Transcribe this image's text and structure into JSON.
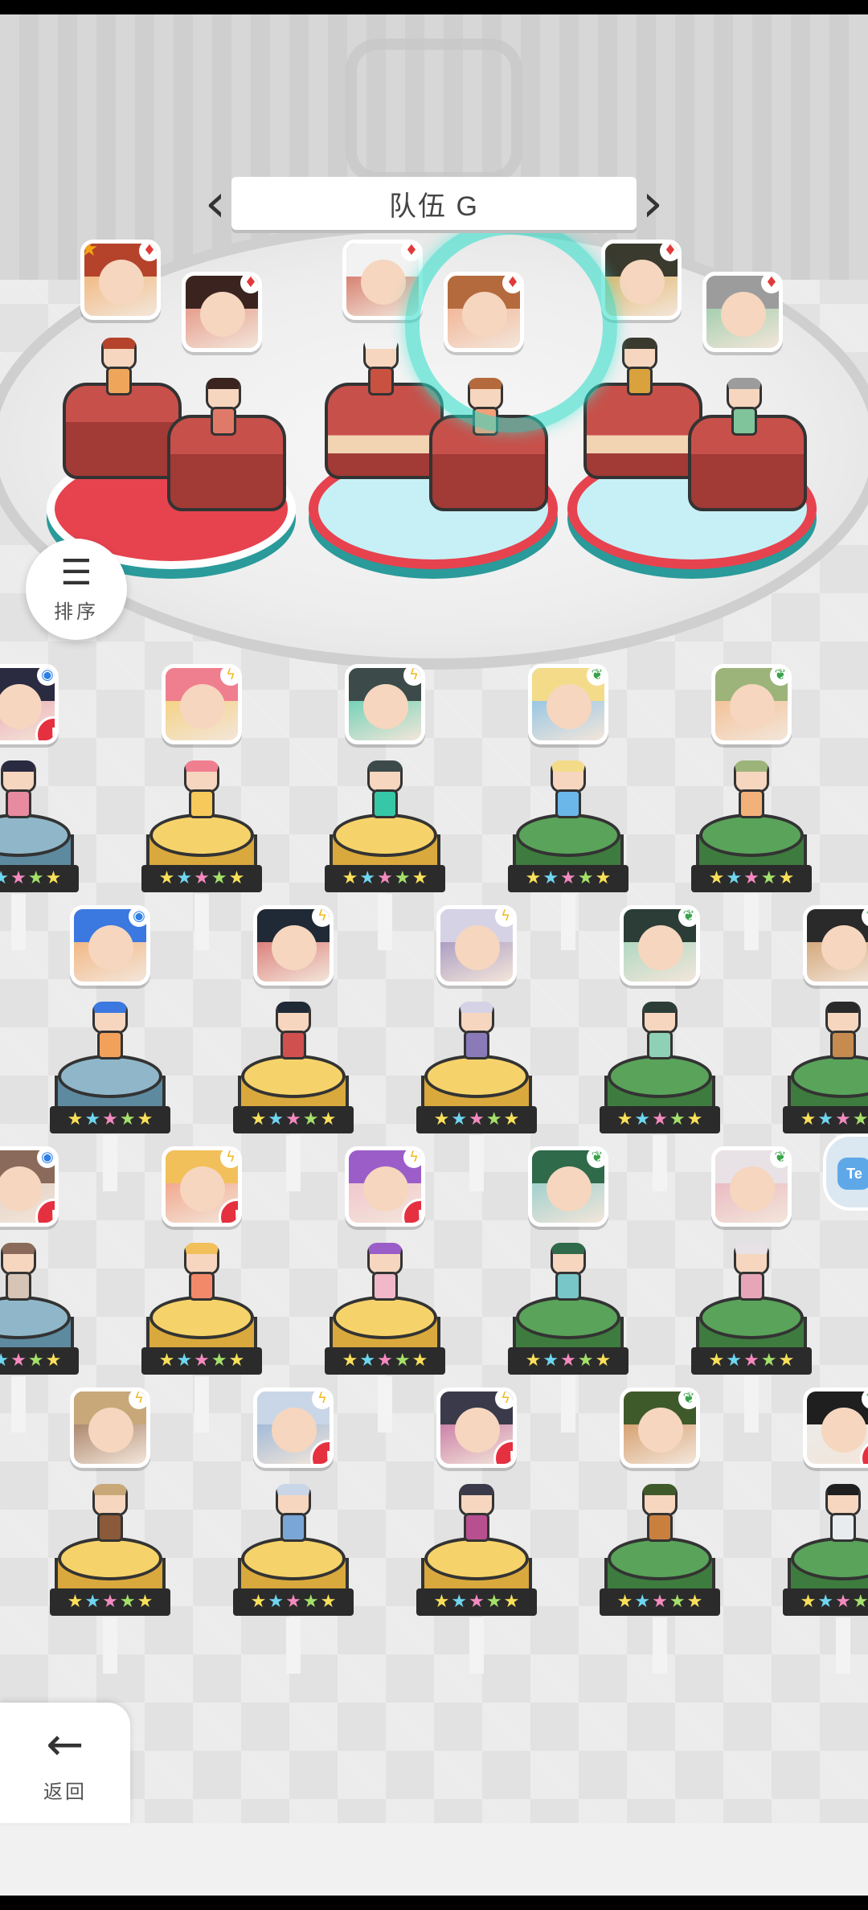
{
  "team": {
    "name": "队伍 G",
    "prev_icon": "chevron-left-icon",
    "next_icon": "chevron-right-icon"
  },
  "buttons": {
    "sort_label": "排序",
    "sort_icon": "sort-descending-icon",
    "back_label": "返回",
    "back_icon": "arrow-left-icon",
    "side_tab_text": "Te"
  },
  "team_slots": [
    {
      "base_color": "red",
      "members": [
        {
          "element": "fire",
          "crown": true,
          "rank_star": true,
          "palette": [
            "#b5432b",
            "#f0a65a"
          ]
        },
        {
          "element": "fire",
          "crown": true,
          "rank_star": false,
          "palette": [
            "#3b2420",
            "#e07a68"
          ]
        }
      ]
    },
    {
      "base_color": "blue",
      "members": [
        {
          "element": "fire",
          "crown": true,
          "rank_star": false,
          "palette": [
            "#f2f2f2",
            "#c9513f"
          ]
        },
        {
          "element": "fire",
          "crown": true,
          "rank_star": false,
          "palette": [
            "#b46a3d",
            "#f2a07a"
          ]
        }
      ]
    },
    {
      "base_color": "blue",
      "members": [
        {
          "element": "fire",
          "crown": true,
          "rank_star": false,
          "palette": [
            "#3a3a2f",
            "#d9a23c"
          ]
        },
        {
          "element": "fire",
          "crown": true,
          "rank_star": false,
          "palette": [
            "#9c9c9c",
            "#7fc49a"
          ]
        }
      ]
    }
  ],
  "roster": [
    [
      {
        "element": "water",
        "crown": false,
        "alert": true,
        "base": "blue",
        "stars": 5,
        "palette": [
          "#2a2a40",
          "#e88aa0"
        ]
      },
      {
        "element": "light",
        "crown": true,
        "alert": false,
        "base": "gold",
        "stars": 5,
        "palette": [
          "#ef7f8f",
          "#f6c95a"
        ]
      },
      {
        "element": "light",
        "crown": true,
        "alert": false,
        "base": "gold",
        "stars": 5,
        "palette": [
          "#3c4a4a",
          "#36c8a6"
        ]
      },
      {
        "element": "nature",
        "crown": true,
        "alert": false,
        "base": "green",
        "stars": 5,
        "palette": [
          "#f4db8a",
          "#6bb7e9"
        ]
      },
      {
        "element": "nature",
        "crown": true,
        "alert": false,
        "base": "green",
        "stars": 5,
        "palette": [
          "#9cb47a",
          "#f3b17a"
        ]
      }
    ],
    [
      {
        "element": "water",
        "crown": true,
        "alert": false,
        "base": "blue",
        "stars": 5,
        "palette": [
          "#3b78e0",
          "#f2a15a"
        ]
      },
      {
        "element": "light",
        "crown": true,
        "alert": false,
        "base": "gold",
        "stars": 5,
        "palette": [
          "#1f2a36",
          "#d04f4f"
        ]
      },
      {
        "element": "light",
        "crown": false,
        "alert": false,
        "base": "gold",
        "stars": 5,
        "palette": [
          "#d6d2e6",
          "#8a7ab8"
        ]
      },
      {
        "element": "nature",
        "crown": true,
        "alert": false,
        "base": "green",
        "stars": 5,
        "palette": [
          "#2b3d36",
          "#8fd1b6"
        ]
      },
      {
        "element": "nature",
        "crown": true,
        "alert": false,
        "base": "green",
        "stars": 5,
        "palette": [
          "#2a2a2a",
          "#c58b4f"
        ]
      }
    ],
    [
      {
        "element": "water",
        "crown": false,
        "alert": true,
        "base": "blue",
        "stars": 5,
        "palette": [
          "#8a6a5a",
          "#d6c4b6"
        ]
      },
      {
        "element": "light",
        "crown": false,
        "alert": true,
        "base": "gold",
        "stars": 5,
        "palette": [
          "#f2c05a",
          "#f28a6a"
        ]
      },
      {
        "element": "light",
        "crown": false,
        "alert": true,
        "base": "gold",
        "stars": 5,
        "palette": [
          "#9b5ec9",
          "#f0b8c8"
        ]
      },
      {
        "element": "nature",
        "crown": true,
        "alert": false,
        "base": "green",
        "stars": 5,
        "palette": [
          "#2f6a4a",
          "#78c6c8"
        ]
      },
      {
        "element": "nature",
        "crown": true,
        "alert": false,
        "base": "green",
        "stars": 5,
        "palette": [
          "#e8e2e6",
          "#e6a6b8"
        ]
      }
    ],
    [
      {
        "element": "light",
        "crown": true,
        "alert": false,
        "base": "gold",
        "stars": 5,
        "palette": [
          "#c8a878",
          "#8a5a3a"
        ]
      },
      {
        "element": "light",
        "crown": true,
        "alert": true,
        "base": "gold",
        "stars": 5,
        "palette": [
          "#c9d6e8",
          "#7aa6d6"
        ]
      },
      {
        "element": "light",
        "crown": true,
        "alert": true,
        "base": "gold",
        "stars": 5,
        "palette": [
          "#3a3a4a",
          "#b84f8f"
        ]
      },
      {
        "element": "nature",
        "crown": true,
        "alert": false,
        "base": "green",
        "stars": 5,
        "palette": [
          "#3f5a2a",
          "#c9803f"
        ]
      },
      {
        "element": "nature",
        "crown": false,
        "alert": true,
        "base": "green",
        "stars": 5,
        "palette": [
          "#1f1f1f",
          "#e8ecee"
        ]
      }
    ]
  ],
  "colors": {
    "water": "#2c7fe4",
    "light": "#f2b81d",
    "nature": "#3aa24a",
    "fire": "#e23a3a",
    "alert": "#e53040",
    "crown": "#f6b81e"
  },
  "glyphs": {
    "crown": "♛",
    "star": "★",
    "water": "◉",
    "light": "ϟ",
    "nature": "❦",
    "fire": "♦",
    "alert": "!"
  },
  "star_colors": [
    "#f9e05a",
    "#6ed6f0",
    "#f48ac0",
    "#a4e06a",
    "#f9e05a"
  ]
}
